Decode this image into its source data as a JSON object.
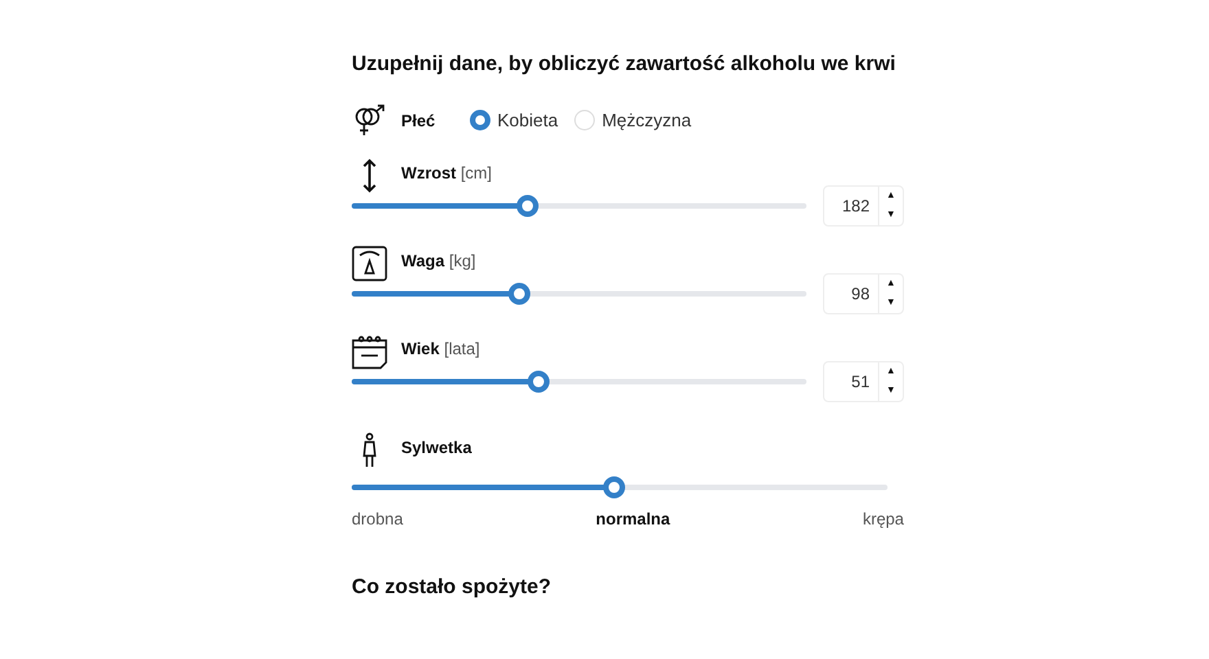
{
  "heading": "Uzupełnij dane, by obliczyć zawartość alkoholu we krwi",
  "sex": {
    "label": "Płeć",
    "options": [
      {
        "label": "Kobieta",
        "selected": true
      },
      {
        "label": "Mężczyzna",
        "selected": false
      }
    ]
  },
  "measures": [
    {
      "kind": "height",
      "label": "Wzrost",
      "unit": "[cm]",
      "level": 0.387,
      "value": "182",
      "up": "▲",
      "down": "▼"
    },
    {
      "kind": "weight",
      "label": "Waga",
      "unit": "[kg]",
      "level": 0.37,
      "value": "98",
      "up": "▲",
      "down": "▼"
    },
    {
      "kind": "age",
      "label": "Wiek",
      "unit": "[lata]",
      "level": 0.41,
      "value": "51",
      "up": "▲",
      "down": "▼"
    }
  ],
  "build": {
    "label": "Sylwetka",
    "level": 0.49,
    "options": [
      {
        "label": "drobna",
        "selected": false
      },
      {
        "label": "normalna",
        "selected": true
      },
      {
        "label": "krępa",
        "selected": false
      }
    ]
  },
  "section_heading": "Co zostało spożyte?"
}
